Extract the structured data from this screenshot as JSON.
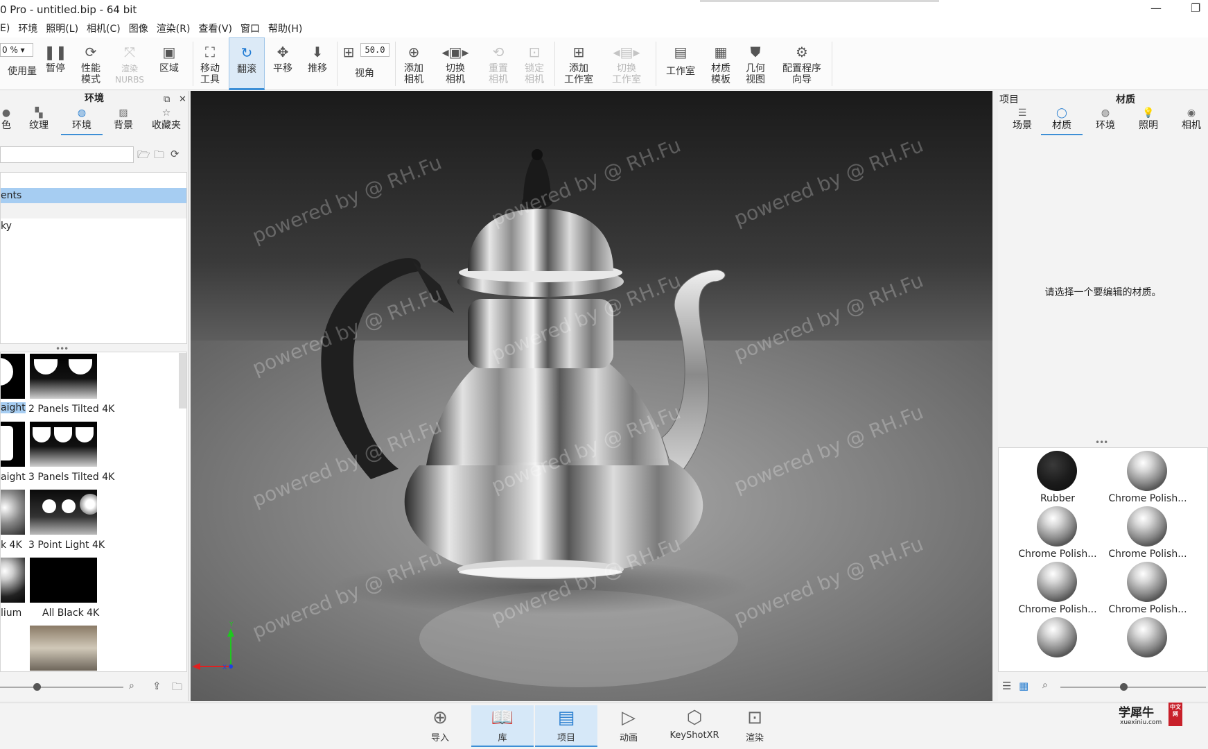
{
  "window": {
    "title": "0 Pro  - untitled.bip  - 64 bit",
    "minimize_glyph": "—",
    "restore_glyph": "❐"
  },
  "menu": [
    "E)",
    "环境",
    "照明(L)",
    "相机(C)",
    "图像",
    "渲染(R)",
    "查看(V)",
    "窗口",
    "帮助(H)"
  ],
  "toolbar": {
    "zoom_value": "0 %",
    "fov_value": "50.0",
    "buttons": [
      {
        "label": "使用量",
        "icon": "usage-icon"
      },
      {
        "label": "暂停",
        "icon": "pause-icon"
      },
      {
        "label": "性能\n模式",
        "icon": "performance-icon"
      },
      {
        "label": "渲染\nNURBS",
        "icon": "nurbs-icon",
        "disabled": true
      },
      {
        "label": "区域",
        "icon": "region-icon"
      },
      {
        "label": "移动\n工具",
        "icon": "move-tool-icon"
      },
      {
        "label": "翻滚",
        "icon": "tumble-icon",
        "active": true
      },
      {
        "label": "平移",
        "icon": "pan-icon"
      },
      {
        "label": "推移",
        "icon": "dolly-icon"
      },
      {
        "label": "视角",
        "icon": "fov-icon"
      },
      {
        "label": "添加\n相机",
        "icon": "add-camera-icon"
      },
      {
        "label": "切换\n相机",
        "icon": "switch-camera-icon"
      },
      {
        "label": "重置\n相机",
        "icon": "reset-camera-icon",
        "disabled": true
      },
      {
        "label": "锁定\n相机",
        "icon": "lock-camera-icon",
        "disabled": true
      },
      {
        "label": "添加\n工作室",
        "icon": "add-studio-icon"
      },
      {
        "label": "切换\n工作室",
        "icon": "switch-studio-icon",
        "disabled": true
      },
      {
        "label": "工作室",
        "icon": "studio-icon"
      },
      {
        "label": "材质\n模板",
        "icon": "material-template-icon"
      },
      {
        "label": "几何\n视图",
        "icon": "geometry-view-icon"
      },
      {
        "label": "配置程序\n向导",
        "icon": "configurator-wizard-icon"
      }
    ]
  },
  "left_panel": {
    "title": "环境",
    "tabs": [
      {
        "label": "色",
        "icon": "color-icon"
      },
      {
        "label": "纹理",
        "icon": "texture-icon"
      },
      {
        "label": "环境",
        "icon": "environment-icon",
        "active": true
      },
      {
        "label": "背景",
        "icon": "background-icon"
      },
      {
        "label": "收藏夹",
        "icon": "favorites-icon"
      }
    ],
    "tree": [
      {
        "label": "ents",
        "selected": true
      },
      {
        "label": "",
        "alt": true
      },
      {
        "label": "ky"
      }
    ],
    "thumbnails": [
      {
        "label": "aight",
        "partial": true
      },
      {
        "label": "2 Panels Tilted 4K"
      },
      {
        "label": "aight",
        "partial": true
      },
      {
        "label": "3 Panels Tilted 4K"
      },
      {
        "label": "k 4K",
        "partial": true
      },
      {
        "label": "3 Point Light 4K"
      },
      {
        "label": "lium",
        "partial": true
      },
      {
        "label": "All Black 4K"
      }
    ]
  },
  "viewport": {
    "watermark": "powered by @ RH.Fu",
    "axis_y": "Y",
    "axis_x": "X"
  },
  "right_panel": {
    "left_label": "项目",
    "title": "材质",
    "tabs": [
      {
        "label": "场景",
        "icon": "scene-icon"
      },
      {
        "label": "材质",
        "icon": "material-icon",
        "active": true
      },
      {
        "label": "环境",
        "icon": "environment-icon"
      },
      {
        "label": "照明",
        "icon": "lighting-icon"
      },
      {
        "label": "相机",
        "icon": "camera-icon"
      }
    ],
    "message": "请选择一个要编辑的材质。",
    "materials": [
      {
        "label": "Rubber",
        "kind": "rubber"
      },
      {
        "label": "Chrome Polish...",
        "kind": "chrome"
      },
      {
        "label": "Chrome Polish...",
        "kind": "chrome"
      },
      {
        "label": "Chrome Polish...",
        "kind": "chrome"
      },
      {
        "label": "Chrome Polish...",
        "kind": "chrome"
      },
      {
        "label": "Chrome Polish...",
        "kind": "chrome"
      },
      {
        "label": "",
        "kind": "chrome"
      },
      {
        "label": "",
        "kind": "chrome"
      }
    ]
  },
  "bottom_bar": {
    "buttons": [
      {
        "label": "导入",
        "icon": "import-icon"
      },
      {
        "label": "库",
        "icon": "library-icon",
        "active": true
      },
      {
        "label": "项目",
        "icon": "project-icon",
        "active": true
      },
      {
        "label": "动画",
        "icon": "animation-icon"
      },
      {
        "label": "KeyShotXR",
        "icon": "keyshotxr-icon"
      },
      {
        "label": "渲染",
        "icon": "render-icon"
      }
    ]
  },
  "logo": {
    "text": "学犀牛",
    "sub": "xuexiniu.com",
    "seal": "中文网"
  },
  "colors": {
    "accent": "#3d8fd6",
    "selection": "#a6cdf2"
  }
}
